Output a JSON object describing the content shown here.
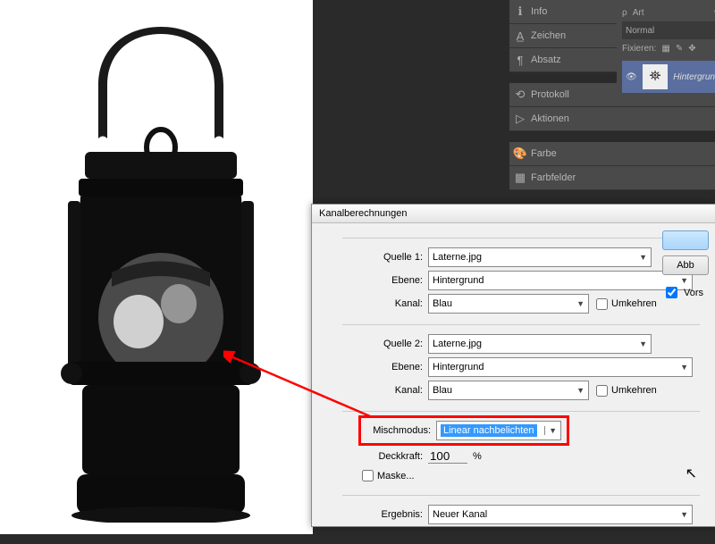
{
  "panels": {
    "info": "Info",
    "zeichen": "Zeichen",
    "absatz": "Absatz",
    "protokoll": "Protokoll",
    "aktionen": "Aktionen",
    "farbe": "Farbe",
    "farbfelder": "Farbfelder"
  },
  "layers": {
    "type_label": "Art",
    "blend": "Normal",
    "lock_label": "Fixieren:",
    "layer_name": "Hintergrun"
  },
  "dialog": {
    "title": "Kanalberechnungen",
    "source1": {
      "label": "Quelle 1:",
      "file": "Laterne.jpg",
      "layer_label": "Ebene:",
      "layer": "Hintergrund",
      "channel_label": "Kanal:",
      "channel": "Blau",
      "invert": "Umkehren"
    },
    "source2": {
      "label": "Quelle 2:",
      "file": "Laterne.jpg",
      "layer_label": "Ebene:",
      "layer": "Hintergrund",
      "channel_label": "Kanal:",
      "channel": "Blau",
      "invert": "Umkehren"
    },
    "blend": {
      "label": "Mischmodus:",
      "value": "Linear nachbelichten"
    },
    "opacity": {
      "label": "Deckkraft:",
      "value": "100",
      "unit": "%"
    },
    "mask": "Maske...",
    "result": {
      "label": "Ergebnis:",
      "value": "Neuer Kanal"
    },
    "buttons": {
      "cancel": "Abb",
      "preview": "Vors"
    }
  }
}
